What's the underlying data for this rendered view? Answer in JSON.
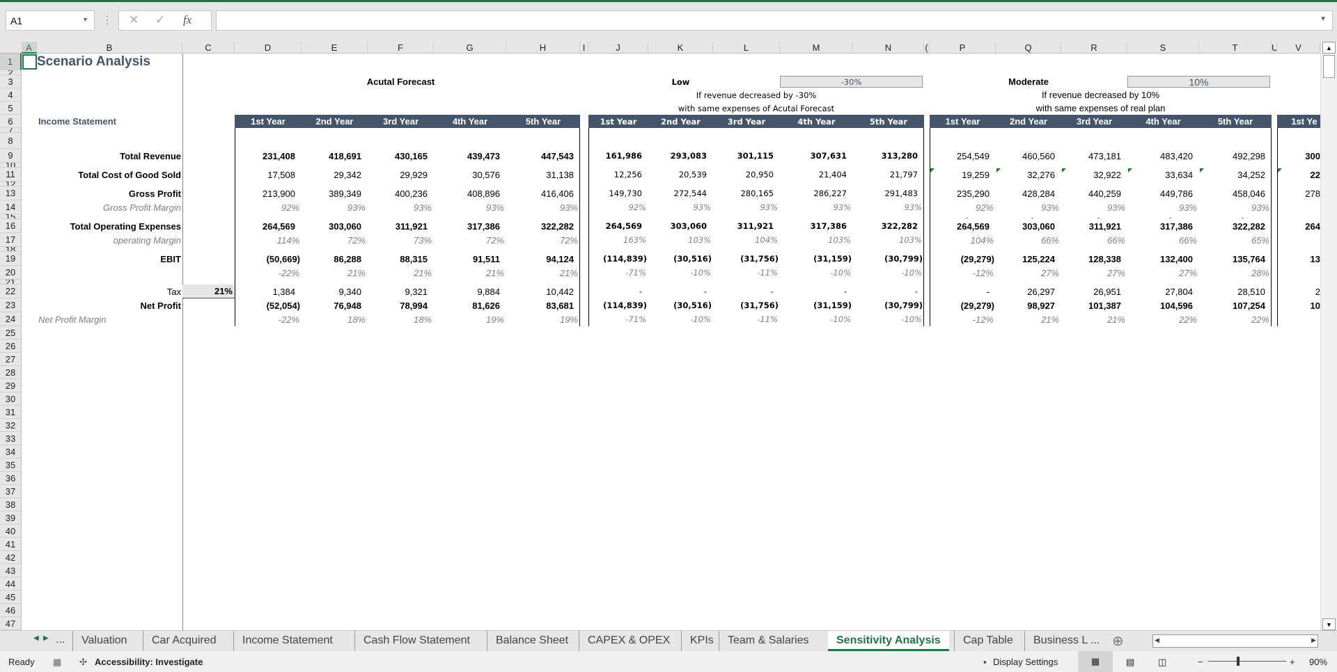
{
  "formula_bar": {
    "name_box": "A1",
    "cancel_icon": "✕",
    "enter_icon": "✓",
    "fx_label": "fx",
    "formula": ""
  },
  "columns": [
    "A",
    "B",
    "C",
    "D",
    "E",
    "F",
    "G",
    "H",
    "I",
    "J",
    "K",
    "L",
    "M",
    "N",
    "(",
    "P",
    "Q",
    "R",
    "S",
    "T",
    "U",
    "V"
  ],
  "row_numbers": [
    1,
    2,
    3,
    4,
    5,
    6,
    7,
    8,
    9,
    10,
    11,
    12,
    13,
    14,
    15,
    16,
    17,
    18,
    19,
    20,
    21,
    22,
    23,
    24,
    25,
    26,
    27,
    28,
    29,
    30,
    31,
    32,
    33,
    34,
    35,
    36,
    37,
    38,
    39,
    40,
    41,
    42,
    43,
    44,
    45,
    46,
    47
  ],
  "sheet": {
    "title": "Scenario Analysis",
    "section": "Income Statement",
    "labels": {
      "revenue": "Total Revenue",
      "cogs": "Total Cost of Good Sold",
      "gross_profit": "Gross Profit",
      "gpm": "Gross Profit Margin",
      "opex": "Total Operating Expenses",
      "opm": "operating Margin",
      "ebit": "EBIT",
      "tax": "Tax",
      "net_profit": "Net Profit",
      "npm": "Net Profit Margin"
    },
    "tax_rate": "21%",
    "blocks": [
      {
        "label": "Acutal Forecast",
        "subtitle1": "",
        "subtitle2": "",
        "input": "",
        "headers": [
          "1st Year",
          "2nd Year",
          "3rd Year",
          "4th Year",
          "5th Year"
        ],
        "revenue": [
          "231,408",
          "418,691",
          "430,165",
          "439,473",
          "447,543"
        ],
        "cogs": [
          "17,508",
          "29,342",
          "29,929",
          "30,576",
          "31,138"
        ],
        "gross_profit": [
          "213,900",
          "389,349",
          "400,236",
          "408,896",
          "416,406"
        ],
        "gpm": [
          "92%",
          "93%",
          "93%",
          "93%",
          "93%"
        ],
        "opex": [
          "264,569",
          "303,060",
          "311,921",
          "317,386",
          "322,282"
        ],
        "opm": [
          "114%",
          "72%",
          "73%",
          "72%",
          "72%"
        ],
        "ebit": [
          "(50,669)",
          "86,288",
          "88,315",
          "91,511",
          "94,124"
        ],
        "ebit_margin": [
          "-22%",
          "21%",
          "21%",
          "21%",
          "21%"
        ],
        "tax": [
          "1,384",
          "9,340",
          "9,321",
          "9,884",
          "10,442"
        ],
        "net_profit": [
          "(52,054)",
          "76,948",
          "78,994",
          "81,626",
          "83,681"
        ],
        "npm": [
          "-22%",
          "18%",
          "18%",
          "19%",
          "19%"
        ]
      },
      {
        "label": "Low",
        "subtitle1": "If revenue decreased by -30%",
        "subtitle2": "with same expenses of Acutal Forecast",
        "input": "-30%",
        "headers": [
          "1st Year",
          "2nd Year",
          "3rd Year",
          "4th Year",
          "5th Year"
        ],
        "revenue": [
          "161,986",
          "293,083",
          "301,115",
          "307,631",
          "313,280"
        ],
        "cogs": [
          "12,256",
          "20,539",
          "20,950",
          "21,404",
          "21,797"
        ],
        "gross_profit": [
          "149,730",
          "272,544",
          "280,165",
          "286,227",
          "291,483"
        ],
        "gpm": [
          "92%",
          "93%",
          "93%",
          "93%",
          "93%"
        ],
        "opex": [
          "264,569",
          "303,060",
          "311,921",
          "317,386",
          "322,282"
        ],
        "opm": [
          "163%",
          "103%",
          "104%",
          "103%",
          "103%"
        ],
        "ebit": [
          "(114,839)",
          "(30,516)",
          "(31,756)",
          "(31,159)",
          "(30,799)"
        ],
        "ebit_margin": [
          "-71%",
          "-10%",
          "-11%",
          "-10%",
          "-10%"
        ],
        "tax": [
          "-",
          "-",
          "-",
          "-",
          "-"
        ],
        "net_profit": [
          "(114,839)",
          "(30,516)",
          "(31,756)",
          "(31,159)",
          "(30,799)"
        ],
        "npm": [
          "-71%",
          "-10%",
          "-11%",
          "-10%",
          "-10%"
        ]
      },
      {
        "label": "Moderate",
        "subtitle1": "If revenue decreased by 10%",
        "subtitle2": "with same expenses of real plan",
        "input": "10%",
        "headers": [
          "1st Year",
          "2nd Year",
          "3rd Year",
          "4th Year",
          "5th Year"
        ],
        "revenue": [
          "254,549",
          "460,560",
          "473,181",
          "483,420",
          "492,298"
        ],
        "cogs": [
          "19,259",
          "32,276",
          "32,922",
          "33,634",
          "34,252"
        ],
        "gross_profit": [
          "235,290",
          "428,284",
          "440,259",
          "449,786",
          "458,046"
        ],
        "gpm": [
          "92%",
          "93%",
          "93%",
          "93%",
          "93%"
        ],
        "dash": [
          "-",
          "-",
          "-",
          "-",
          "-"
        ],
        "opex": [
          "264,569",
          "303,060",
          "311,921",
          "317,386",
          "322,282"
        ],
        "opm": [
          "104%",
          "66%",
          "66%",
          "66%",
          "65%"
        ],
        "ebit": [
          "(29,279)",
          "125,224",
          "128,338",
          "132,400",
          "135,764"
        ],
        "ebit_margin": [
          "-12%",
          "27%",
          "27%",
          "27%",
          "28%"
        ],
        "tax": [
          "-",
          "26,297",
          "26,951",
          "27,804",
          "28,510"
        ],
        "net_profit": [
          "(29,279)",
          "98,927",
          "101,387",
          "104,596",
          "107,254"
        ],
        "npm": [
          "-12%",
          "21%",
          "21%",
          "22%",
          "22%"
        ]
      }
    ],
    "partial_column": {
      "header": "1st Ye",
      "revenue": "300",
      "cogs": "22",
      "gross_profit": "278",
      "opex": "264",
      "ebit": "13",
      "tax": "2",
      "net_profit": "10"
    }
  },
  "tabs": {
    "nav_prev": "◀",
    "nav_next": "▶",
    "more": "...",
    "items": [
      "Valuation",
      "Car Acquired",
      "Income Statement",
      "Cash Flow Statement",
      "Balance Sheet",
      "CAPEX & OPEX",
      "KPIs",
      "Team & Salaries",
      "Sensitivity Analysis",
      "Cap Table",
      "Business L ..."
    ],
    "active": "Sensitivity Analysis",
    "add_icon": "⊕"
  },
  "status": {
    "ready": "Ready",
    "accessibility": "Accessibility: Investigate",
    "display_settings": "Display Settings",
    "zoom": "90%",
    "zoom_level": 90
  },
  "colors": {
    "accent": "#217346",
    "header_fill": "#44546a",
    "input_fill": "#e7e6e6"
  }
}
